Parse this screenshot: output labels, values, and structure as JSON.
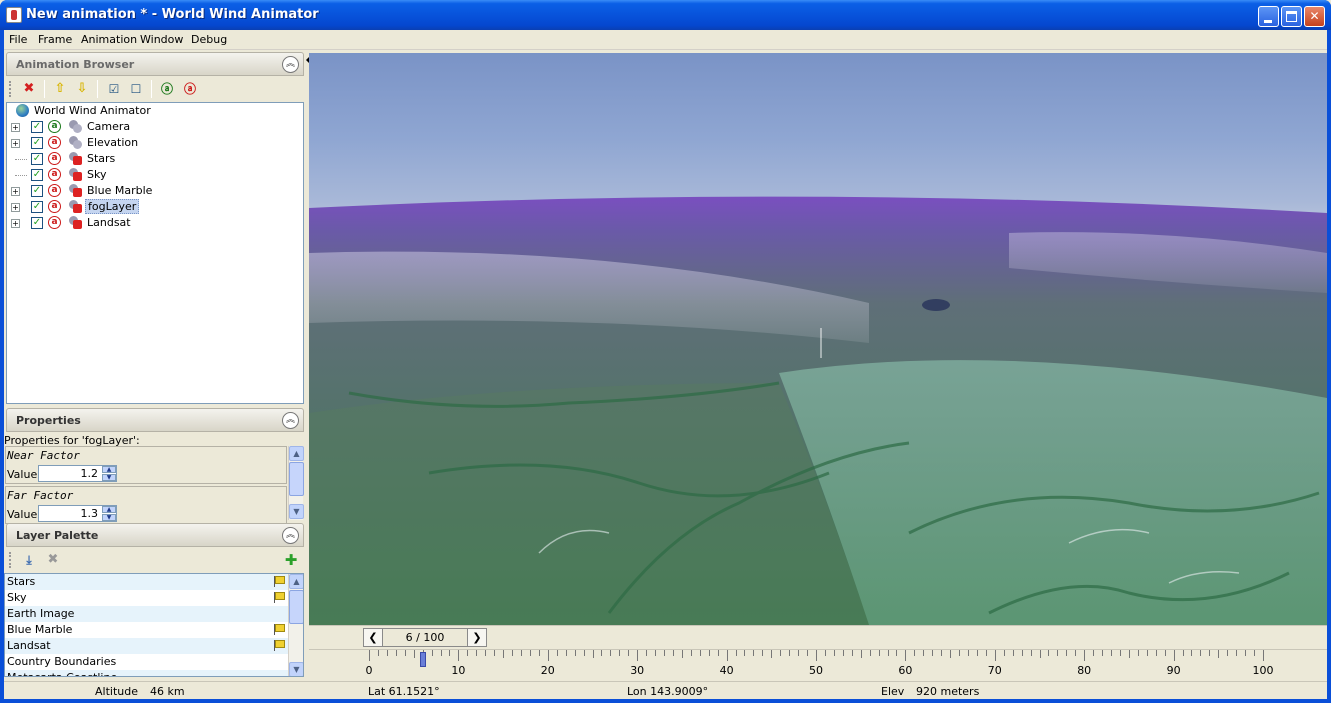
{
  "window": {
    "title": "New animation * - World Wind Animator"
  },
  "menu": [
    "File",
    "Frame",
    "Animation",
    "Window",
    "Debug"
  ],
  "animation_browser": {
    "title": "Animation Browser",
    "toolbar_icons": [
      "delete-icon",
      "move-up-icon",
      "move-down-icon",
      "check-all-icon",
      "uncheck-all-icon",
      "animate-on-icon",
      "animate-off-icon"
    ],
    "root": "World Wind Animator",
    "nodes": [
      {
        "label": "Camera",
        "expandable": true,
        "checked": true,
        "animated": "green",
        "icon": "camera"
      },
      {
        "label": "Elevation",
        "expandable": true,
        "checked": true,
        "animated": "red",
        "icon": "elevation"
      },
      {
        "label": "Stars",
        "expandable": false,
        "checked": true,
        "animated": "red",
        "icon": "layer"
      },
      {
        "label": "Sky",
        "expandable": false,
        "checked": true,
        "animated": "red",
        "icon": "layer"
      },
      {
        "label": "Blue Marble",
        "expandable": true,
        "checked": true,
        "animated": "red",
        "icon": "layer"
      },
      {
        "label": "fogLayer",
        "expandable": true,
        "checked": true,
        "animated": "red",
        "icon": "layer",
        "selected": true
      },
      {
        "label": "Landsat",
        "expandable": true,
        "checked": true,
        "animated": "red",
        "icon": "layer"
      }
    ]
  },
  "properties": {
    "title": "Properties",
    "subtitle": "Properties for 'fogLayer':",
    "items": [
      {
        "name": "Near Factor",
        "value_label": "Value:",
        "value": "1.2"
      },
      {
        "name": "Far Factor",
        "value_label": "Value:",
        "value": "1.3"
      }
    ]
  },
  "layer_palette": {
    "title": "Layer Palette",
    "layers": [
      {
        "name": "Stars",
        "flag": true
      },
      {
        "name": "Sky",
        "flag": true
      },
      {
        "name": "Earth Image",
        "flag": false
      },
      {
        "name": "Blue Marble",
        "flag": true
      },
      {
        "name": "Landsat",
        "flag": true
      },
      {
        "name": "Country Boundaries",
        "flag": false
      },
      {
        "name": "Metacarta Coastline",
        "flag": false
      }
    ]
  },
  "timeline": {
    "frame_display": "6 / 100",
    "current_frame": 6,
    "total_frames": 100,
    "tick_labels": [
      "0",
      "10",
      "20",
      "30",
      "40",
      "50",
      "60",
      "70",
      "80",
      "90",
      "100"
    ]
  },
  "status": {
    "altitude_label": "Altitude",
    "altitude_value": "46 km",
    "lat": "Lat 61.1521°",
    "lon": "Lon 143.9009°",
    "elev_label": "Elev",
    "elev_value": "920 meters"
  },
  "colors": {
    "titlebar": "#0853db",
    "fog_horizon": "#7a4fc0",
    "terrain_green": "#3f7a52"
  }
}
